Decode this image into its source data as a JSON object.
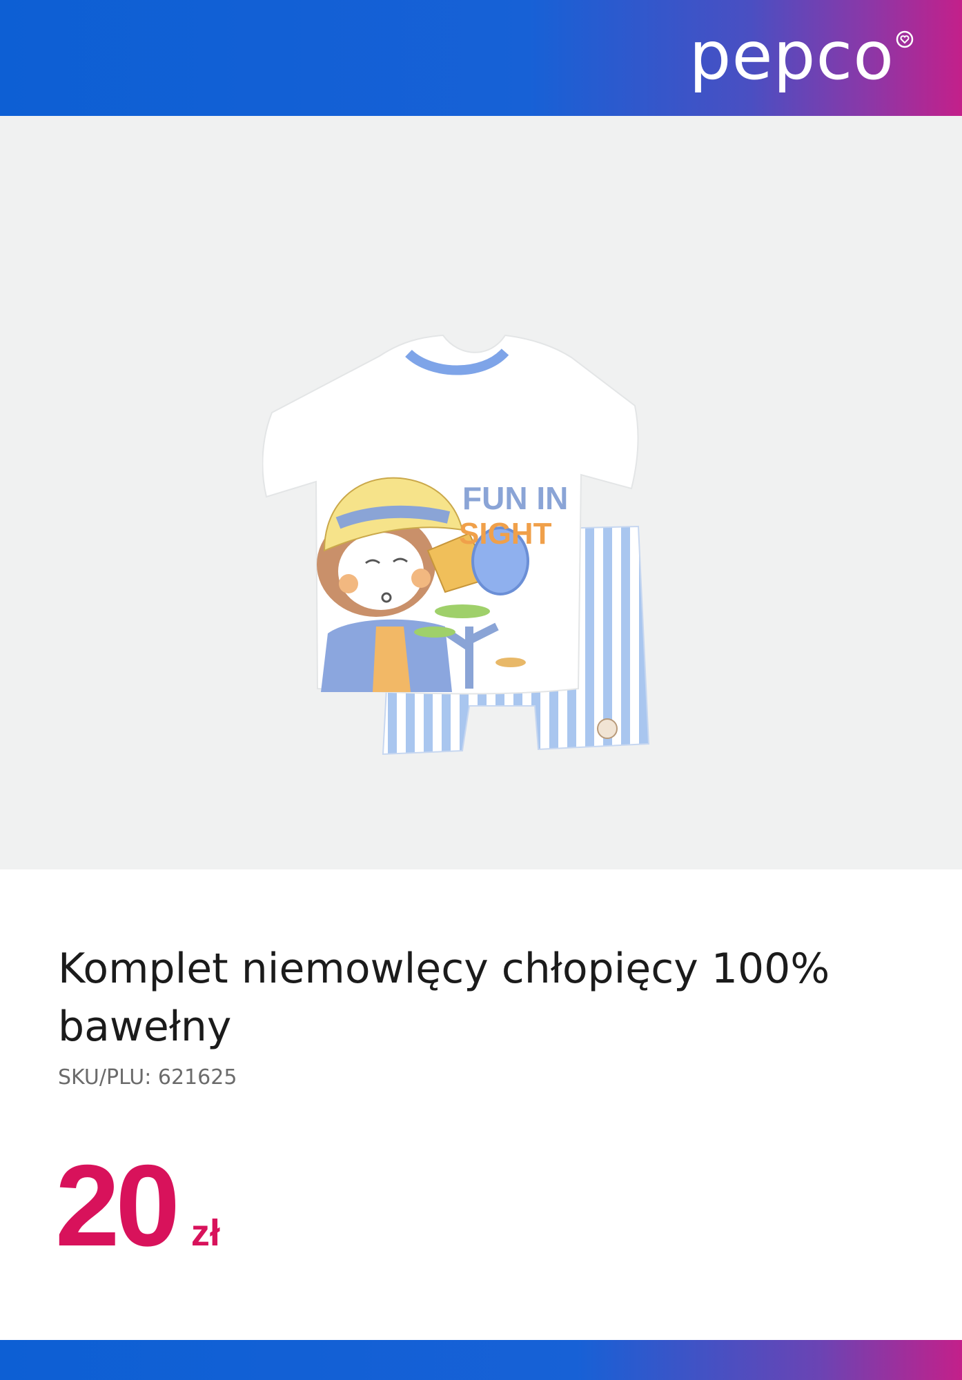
{
  "brand": {
    "logo_text": "pepco",
    "logo_icon": "heart-icon",
    "header_gradient": [
      "#0d5fd4",
      "#c3208a"
    ]
  },
  "product": {
    "image_icon": "kids-tshirt-shorts-set-image",
    "print_text_line1": "FUN IN",
    "print_text_line2": "SIGHT",
    "title": "Komplet niemowlęcy chłopięcy 100% bawełny",
    "sku": "SKU/PLU: 621625",
    "price": "20",
    "currency": "zł",
    "price_color": "#d8125b"
  }
}
